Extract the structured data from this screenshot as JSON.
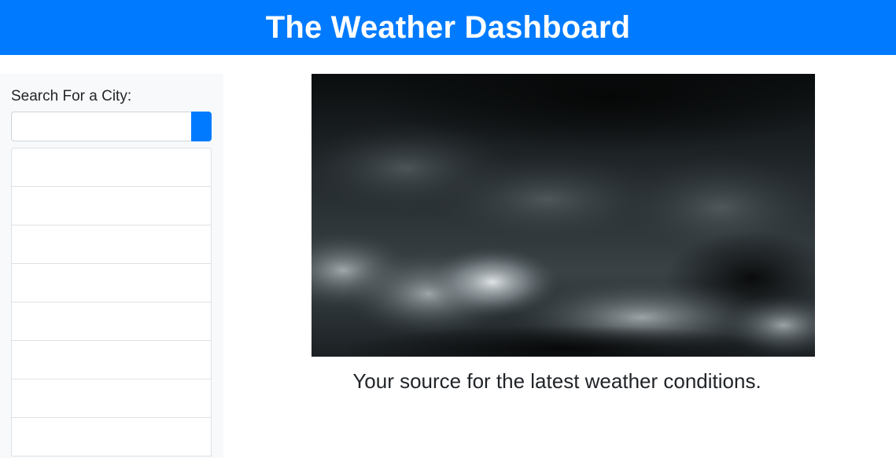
{
  "header": {
    "title": "The Weather Dashboard"
  },
  "sidebar": {
    "search_label": "Search For a City:",
    "search_value": "",
    "search_placeholder": "",
    "search_button_icon": "search-icon",
    "history_items": [
      "",
      "",
      "",
      "",
      "",
      "",
      "",
      ""
    ]
  },
  "main": {
    "hero_image": "storm-clouds-image",
    "tagline": "Your source for the latest weather conditions."
  },
  "colors": {
    "primary": "#007bff",
    "sidebar_bg": "#f8f9fa",
    "text": "#212529"
  }
}
